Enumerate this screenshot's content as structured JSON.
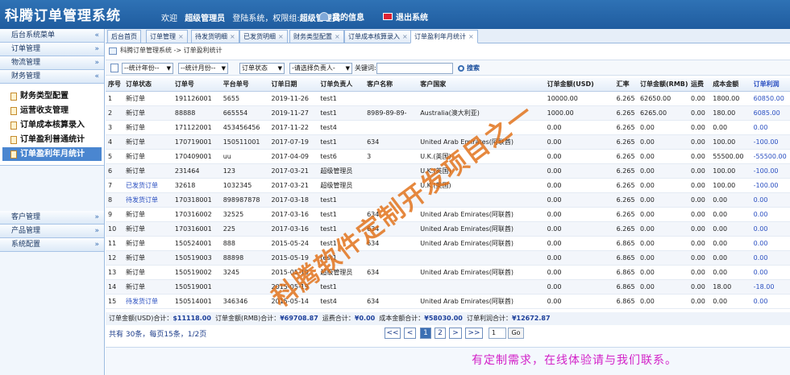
{
  "header": {
    "brand": "科腾订单管理系统",
    "welcome": "欢迎",
    "user": "超级管理员",
    "role_prefix": "登陆系统，权限组:",
    "role": "超级管理员",
    "my_info": "我的信息",
    "logout": "退出系统"
  },
  "sidebar": {
    "sections": [
      {
        "label": "后台系统菜单",
        "chev": "«"
      },
      {
        "label": "订单管理",
        "chev": "»"
      },
      {
        "label": "物流管理",
        "chev": "»"
      },
      {
        "label": "财务管理",
        "chev": "«"
      }
    ],
    "finance_items": [
      "财务类型配置",
      "运营收支管理",
      "订单成本核算录入",
      "订单盈利普通统计",
      "订单盈利年月统计"
    ],
    "bottom_sections": [
      {
        "label": "客户管理",
        "chev": "»"
      },
      {
        "label": "产品管理",
        "chev": "»"
      },
      {
        "label": "系统配置",
        "chev": "»"
      }
    ]
  },
  "tabs": [
    "后台首页",
    "订单管理",
    "待发货明细",
    "已发货明细",
    "财务类型配置",
    "订单成本核算录入",
    "订单盈利年月统计"
  ],
  "breadcrumb": "科腾订单管理系统 -> 订单盈利统计",
  "filters": {
    "year": "--统计年份--",
    "month": "--统计月份--",
    "status": "订单状态",
    "owner": "-请选择负责人-",
    "keyword_label": "关键词:",
    "keyword_value": "",
    "search": "搜索"
  },
  "table": {
    "headers": [
      "序号",
      "订单状态",
      "订单号",
      "平台单号",
      "订单日期",
      "订单负责人",
      "客户名称",
      "客户国家",
      "订单金额(USD)",
      "汇率",
      "订单金额(RMB)",
      "运费",
      "成本金额",
      "订单利润"
    ],
    "rows": [
      [
        "1",
        "新订单",
        "191126001",
        "5655",
        "2019-11-26",
        "test1",
        "",
        "",
        "10000.00",
        "6.265",
        "62650.00",
        "0.00",
        "1800.00",
        "60850.00"
      ],
      [
        "2",
        "新订单",
        "88888",
        "665554",
        "2019-11-27",
        "test1",
        "8989-89-89-",
        "Australia(澳大利亚)",
        "1000.00",
        "6.265",
        "6265.00",
        "0.00",
        "180.00",
        "6085.00"
      ],
      [
        "3",
        "新订单",
        "171122001",
        "453456456",
        "2017-11-22",
        "test4",
        "",
        "",
        "0.00",
        "6.265",
        "0.00",
        "0.00",
        "0.00",
        "0.00"
      ],
      [
        "4",
        "新订单",
        "170719001",
        "150511001",
        "2017-07-19",
        "test1",
        "634",
        "United Arab Emirates(阿联酋)",
        "0.00",
        "6.265",
        "0.00",
        "0.00",
        "100.00",
        "-100.00"
      ],
      [
        "5",
        "新订单",
        "170409001",
        "uu",
        "2017-04-09",
        "test6",
        "3",
        "U.K.(英国)",
        "0.00",
        "6.265",
        "0.00",
        "0.00",
        "55500.00",
        "-55500.00"
      ],
      [
        "6",
        "新订单",
        "231464",
        "123",
        "2017-03-21",
        "超级管理员",
        "",
        "U.K.(英国)",
        "0.00",
        "6.265",
        "0.00",
        "0.00",
        "100.00",
        "-100.00"
      ],
      [
        "7",
        "已发货订单",
        "32618",
        "1032345",
        "2017-03-21",
        "超级管理员",
        "",
        "U.K.(英国)",
        "0.00",
        "6.265",
        "0.00",
        "0.00",
        "100.00",
        "-100.00"
      ],
      [
        "8",
        "待发货订单",
        "170318001",
        "898987878",
        "2017-03-18",
        "test1",
        "",
        "",
        "0.00",
        "6.265",
        "0.00",
        "0.00",
        "0.00",
        "0.00"
      ],
      [
        "9",
        "新订单",
        "170316002",
        "32525",
        "2017-03-16",
        "test1",
        "634",
        "United Arab Emirates(阿联酋)",
        "0.00",
        "6.265",
        "0.00",
        "0.00",
        "0.00",
        "0.00"
      ],
      [
        "10",
        "新订单",
        "170316001",
        "225",
        "2017-03-16",
        "test1",
        "634",
        "United Arab Emirates(阿联酋)",
        "0.00",
        "6.265",
        "0.00",
        "0.00",
        "0.00",
        "0.00"
      ],
      [
        "11",
        "新订单",
        "150524001",
        "888",
        "2015-05-24",
        "test1",
        "634",
        "United Arab Emirates(阿联酋)",
        "0.00",
        "6.865",
        "0.00",
        "0.00",
        "0.00",
        "0.00"
      ],
      [
        "12",
        "新订单",
        "150519003",
        "88898",
        "2015-05-19",
        "test1",
        "",
        "",
        "0.00",
        "6.865",
        "0.00",
        "0.00",
        "0.00",
        "0.00"
      ],
      [
        "13",
        "新订单",
        "150519002",
        "3245",
        "2015-05-19",
        "超级管理员",
        "634",
        "United Arab Emirates(阿联酋)",
        "0.00",
        "6.865",
        "0.00",
        "0.00",
        "0.00",
        "0.00"
      ],
      [
        "14",
        "新订单",
        "150519001",
        "",
        "2015-05-19",
        "test1",
        "",
        "",
        "0.00",
        "6.865",
        "0.00",
        "0.00",
        "18.00",
        "-18.00"
      ],
      [
        "15",
        "待发货订单",
        "150514001",
        "346346",
        "2015-05-14",
        "test4",
        "634",
        "United Arab Emirates(阿联酋)",
        "0.00",
        "6.865",
        "0.00",
        "0.00",
        "0.00",
        "0.00"
      ]
    ]
  },
  "summary": {
    "usd_label": "订单金额(USD)合计：",
    "usd": "$11118.00",
    "rmb_label": "订单金额(RMB)合计：",
    "rmb": "¥69708.87",
    "freight_label": "运费合计：",
    "freight": "¥0.00",
    "cost_label": "成本金额合计：",
    "cost": "¥58030.00",
    "profit_label": "订单利润合计：",
    "profit": "¥12672.87"
  },
  "pager": {
    "info": "共有 30条，每页15条，1/2页",
    "first": "<<",
    "prev": "<",
    "pages": [
      "1",
      "2"
    ],
    "next": ">",
    "last": ">>",
    "input": "1",
    "go": "Go"
  },
  "footer_message": "有定制需求，在线体验请与我们联系。",
  "watermark": "科腾软件定制开发项目之一",
  "colors": {
    "header": "#2f72b5",
    "active": "#4a86d0",
    "link": "#2a4fc1",
    "footer_text": "#d222c8",
    "watermark": "#e16e14"
  }
}
